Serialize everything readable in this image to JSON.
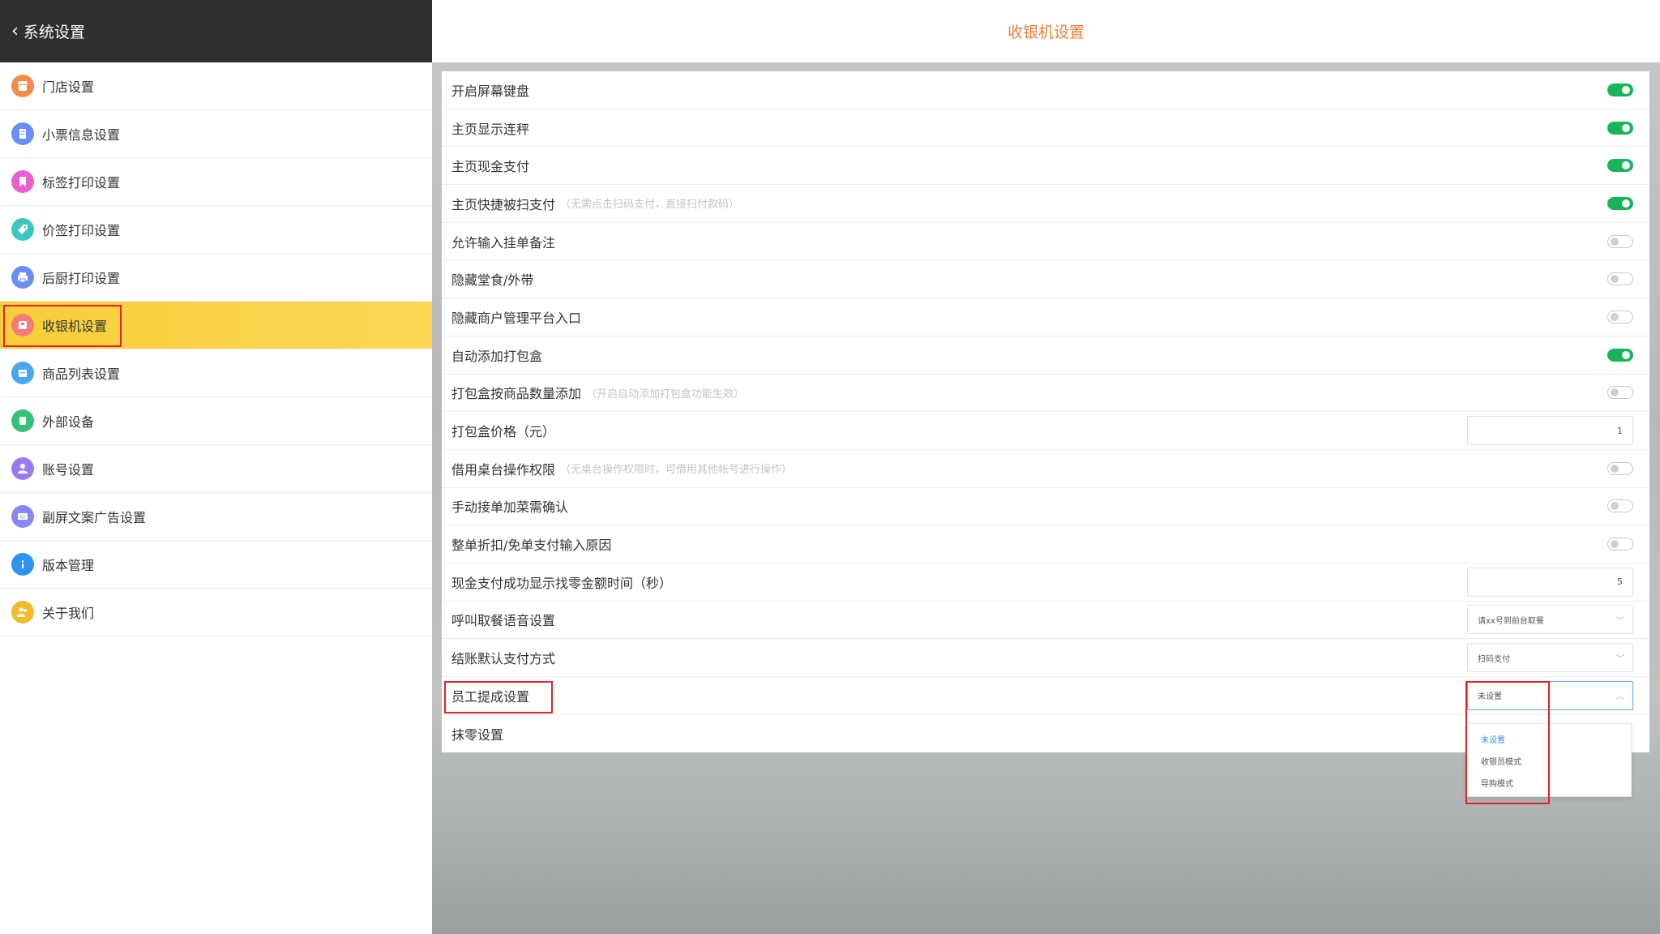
{
  "sidebar": {
    "back_label": "系统设置",
    "items": [
      {
        "label": "门店设置",
        "icon": "store-icon",
        "color": "#f58a4b"
      },
      {
        "label": "小票信息设置",
        "icon": "receipt-icon",
        "color": "#6a8ef5"
      },
      {
        "label": "标签打印设置",
        "icon": "bookmark-icon",
        "color": "#e85fd2"
      },
      {
        "label": "价签打印设置",
        "icon": "price-tag-icon",
        "color": "#3dc6c0"
      },
      {
        "label": "后厨打印设置",
        "icon": "printer-icon",
        "color": "#6a8ef5"
      },
      {
        "label": "收银机设置",
        "icon": "cash-register-icon",
        "color": "#f57b7b"
      },
      {
        "label": "商品列表设置",
        "icon": "product-list-icon",
        "color": "#4aa6ef"
      },
      {
        "label": "外部设备",
        "icon": "device-icon",
        "color": "#36c07a"
      },
      {
        "label": "账号设置",
        "icon": "user-icon",
        "color": "#9b7bf0"
      },
      {
        "label": "副屏文案广告设置",
        "icon": "ad-icon",
        "color": "#8b86f5"
      },
      {
        "label": "版本管理",
        "icon": "info-icon",
        "color": "#2e93ef"
      },
      {
        "label": "关于我们",
        "icon": "team-icon",
        "color": "#f4bb2a"
      }
    ]
  },
  "main": {
    "title": "收银机设置",
    "rows": [
      {
        "label": "开启屏幕键盘",
        "hint": "",
        "type": "toggle",
        "on": true
      },
      {
        "label": "主页显示连秤",
        "hint": "",
        "type": "toggle",
        "on": true
      },
      {
        "label": "主页现金支付",
        "hint": "",
        "type": "toggle",
        "on": true
      },
      {
        "label": "主页快捷被扫支付",
        "hint": "（无需点击扫码支付，直接扫付款码）",
        "type": "toggle",
        "on": true
      },
      {
        "label": "允许输入挂单备注",
        "hint": "",
        "type": "toggle",
        "on": false
      },
      {
        "label": "隐藏堂食/外带",
        "hint": "",
        "type": "toggle",
        "on": false
      },
      {
        "label": "隐藏商户管理平台入口",
        "hint": "",
        "type": "toggle",
        "on": false
      },
      {
        "label": "自动添加打包盒",
        "hint": "",
        "type": "toggle",
        "on": true
      },
      {
        "label": "打包盒按商品数量添加",
        "hint": "（开启自动添加打包盒功能生效）",
        "type": "toggle",
        "on": false
      },
      {
        "label": "打包盒价格（元）",
        "hint": "",
        "type": "input",
        "value": "1"
      },
      {
        "label": "借用桌台操作权限",
        "hint": "（无桌台操作权限时，可借用其他帐号进行操作）",
        "type": "toggle",
        "on": false
      },
      {
        "label": "手动接单加菜需确认",
        "hint": "",
        "type": "toggle",
        "on": false
      },
      {
        "label": "整单折扣/免单支付输入原因",
        "hint": "",
        "type": "toggle",
        "on": false
      },
      {
        "label": "现金支付成功显示找零金额时间（秒）",
        "hint": "",
        "type": "input",
        "value": "5"
      },
      {
        "label": "呼叫取餐语音设置",
        "hint": "",
        "type": "select",
        "value": "请xx号到前台取餐"
      },
      {
        "label": "结账默认支付方式",
        "hint": "",
        "type": "select",
        "value": "扫码支付"
      },
      {
        "label": "员工提成设置",
        "hint": "",
        "type": "select-open",
        "value": "未设置"
      },
      {
        "label": "抹零设置",
        "hint": "",
        "type": "none"
      }
    ],
    "dropdown_options": [
      "未设置",
      "收银员模式",
      "导购模式"
    ],
    "dropdown_selected": "未设置"
  },
  "colors": {
    "accent_orange": "#f07f3c",
    "toggle_on": "#18b45a",
    "active_menu": "#f8cf3a",
    "highlight_red": "#e52222",
    "dropdown_selected": "#3b8ff0"
  }
}
